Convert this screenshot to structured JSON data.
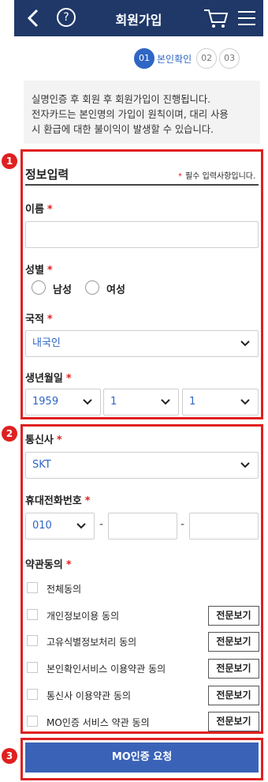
{
  "header": {
    "title": "회원가입",
    "help": "?"
  },
  "steps": [
    {
      "num": "01",
      "label": "본인확인"
    },
    {
      "num": "02"
    },
    {
      "num": "03"
    }
  ],
  "notice": {
    "line1": "실명인증 후 회원 후 회원가입이 진행됩니다.",
    "line2": "전자카드는 본인명의 가입이 원칙이며, 대리 사용",
    "line3": "시 환급에 대한 불이익이 발생할 수 있습니다."
  },
  "badges": [
    "1",
    "2",
    "3"
  ],
  "section1": {
    "title": "정보입력",
    "note_star": "*",
    "note": "필수 입력사항입니다.",
    "name_label": "이름",
    "gender_label": "성별",
    "gender_male": "남성",
    "gender_female": "여성",
    "nationality_label": "국적",
    "nationality_value": "내국인",
    "birth_label": "생년월일",
    "birth_year": "1959",
    "birth_month": "1",
    "birth_day": "1"
  },
  "section2": {
    "carrier_label": "통신사",
    "carrier_value": "SKT",
    "phone_label": "휴대전화번호",
    "phone_prefix": "010",
    "phone_sep": "-",
    "terms_label": "약관동의",
    "terms": [
      {
        "label": "전체동의"
      },
      {
        "label": "개인정보이용 동의",
        "button": "전문보기"
      },
      {
        "label": "고유식별정보처리 동의",
        "button": "전문보기"
      },
      {
        "label": "본인확인서비스 이용약관 동의",
        "button": "전문보기"
      },
      {
        "label": "통신사 이용약관 동의",
        "button": "전문보기"
      },
      {
        "label": "MO인증 서비스 약관 동의",
        "button": "전문보기"
      }
    ]
  },
  "required_mark": "*",
  "submit_label": "MO인증 요청",
  "colors": {
    "header": "#1f3868",
    "accent": "#2f66c5",
    "highlight": "#e02020",
    "button": "#3a63b8"
  }
}
